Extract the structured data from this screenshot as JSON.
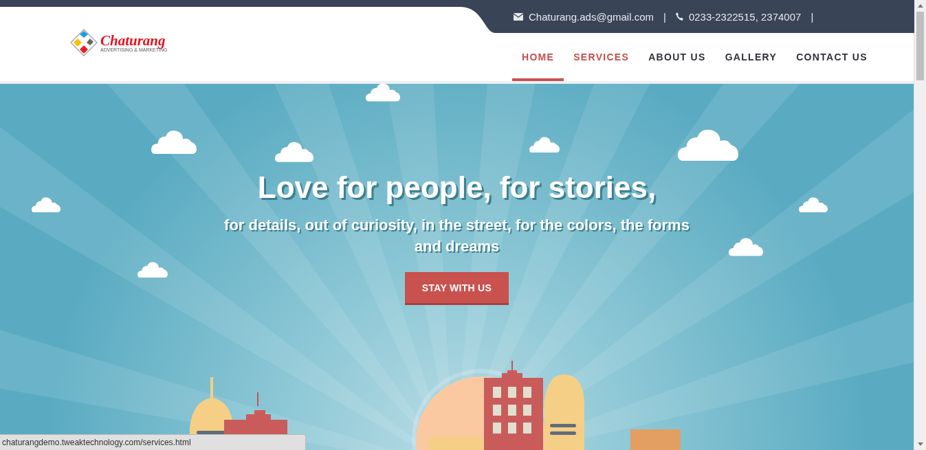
{
  "topbar": {
    "contacts": [
      {
        "kind": "email",
        "text": "Chaturang.ads@gmail.com",
        "separator": "|"
      },
      {
        "kind": "phone",
        "text": "0233-2322515, 2374007",
        "separator": "|"
      }
    ]
  },
  "logo": {
    "name": "Chaturang",
    "tagline": "ADVERTISING & MARKETING"
  },
  "nav": [
    {
      "label": "HOME",
      "selected": true,
      "hovered": false
    },
    {
      "label": "SERVICES",
      "selected": false,
      "hovered": true
    },
    {
      "label": "ABOUT US",
      "selected": false,
      "hovered": false
    },
    {
      "label": "GALLERY",
      "selected": false,
      "hovered": false
    },
    {
      "label": "CONTACT US",
      "selected": false,
      "hovered": false
    }
  ],
  "hero": {
    "title": "Love for people, for stories,",
    "subtitle": "for details, out of curiosity, in the street, for the colors, the forms and dreams",
    "button": "STAY WITH US"
  },
  "status_bar": {
    "url": "chaturangdemo.tweaktechnology.com/services.html"
  }
}
